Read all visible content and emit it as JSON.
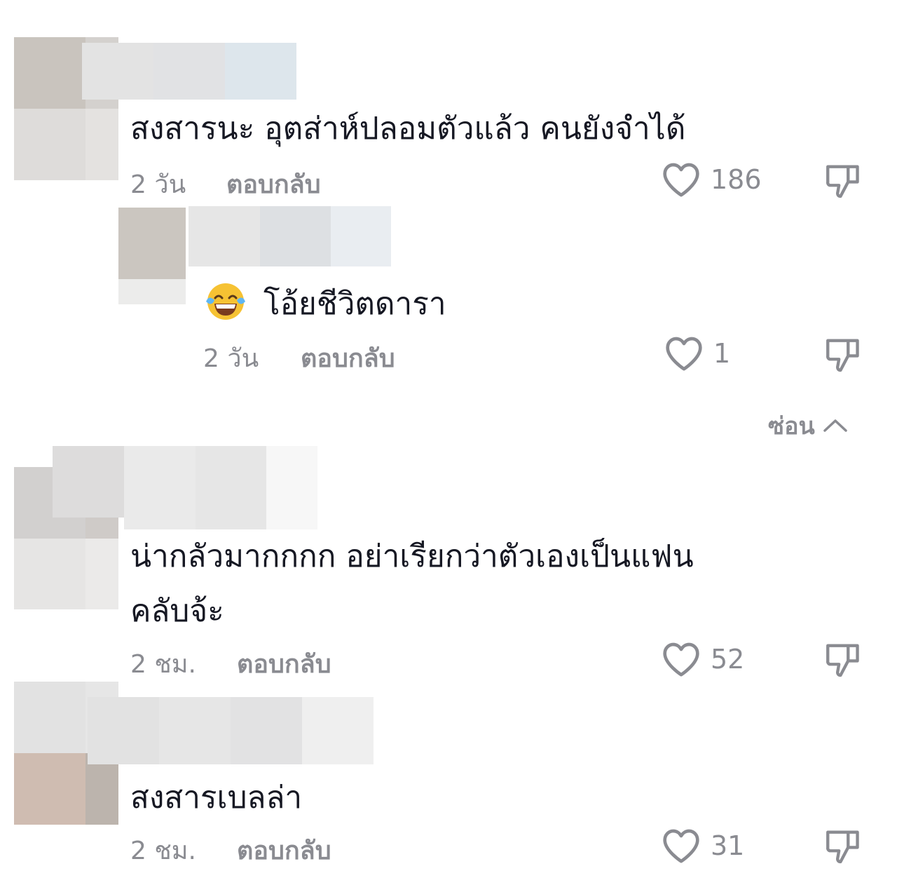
{
  "comments": [
    {
      "text": "สงสารนะ อุตส่าห์ปลอมตัวแล้ว คนยังจำได้",
      "time": "2 วัน",
      "reply_label": "ตอบกลับ",
      "likes": "186"
    },
    {
      "text": "โอ้ยชีวิตดารา",
      "time": "2 วัน",
      "reply_label": "ตอบกลับ",
      "likes": "1",
      "emoji": "face-with-tears-of-joy"
    },
    {
      "text_line1": "น่ากลัวมากกกก อย่าเรียกว่าตัวเองเป็นแฟน",
      "text_line2": "คลับจ้ะ",
      "time": "2 ชม.",
      "reply_label": "ตอบกลับ",
      "likes": "52"
    },
    {
      "text": "สงสารเบลล่า",
      "time": "2 ชม.",
      "reply_label": "ตอบกลับ",
      "likes": "31"
    }
  ],
  "hide_label": "ซ่อน",
  "icons": {
    "like": "heart-outline-icon",
    "dislike": "thumbs-down-outline-icon",
    "collapse": "chevron-up-icon"
  }
}
